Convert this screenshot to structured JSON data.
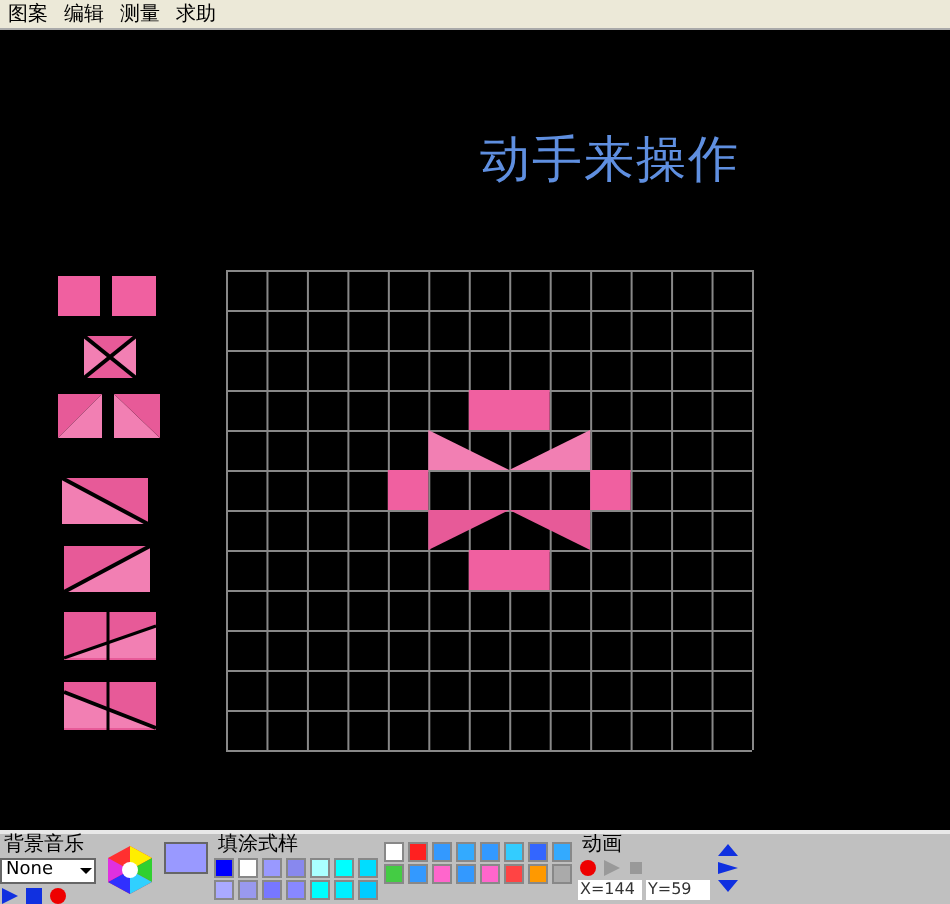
{
  "menu": [
    {
      "label": "图案"
    },
    {
      "label": "编辑"
    },
    {
      "label": "测量"
    },
    {
      "label": "求助"
    }
  ],
  "canvas": {
    "title": "动手来操作"
  },
  "toolbar": {
    "music_label": "背景音乐",
    "music_select": "None",
    "fill_label": "填涂式样",
    "animation_label": "动画",
    "x_reading": "X=144",
    "y_reading": "Y=59"
  }
}
